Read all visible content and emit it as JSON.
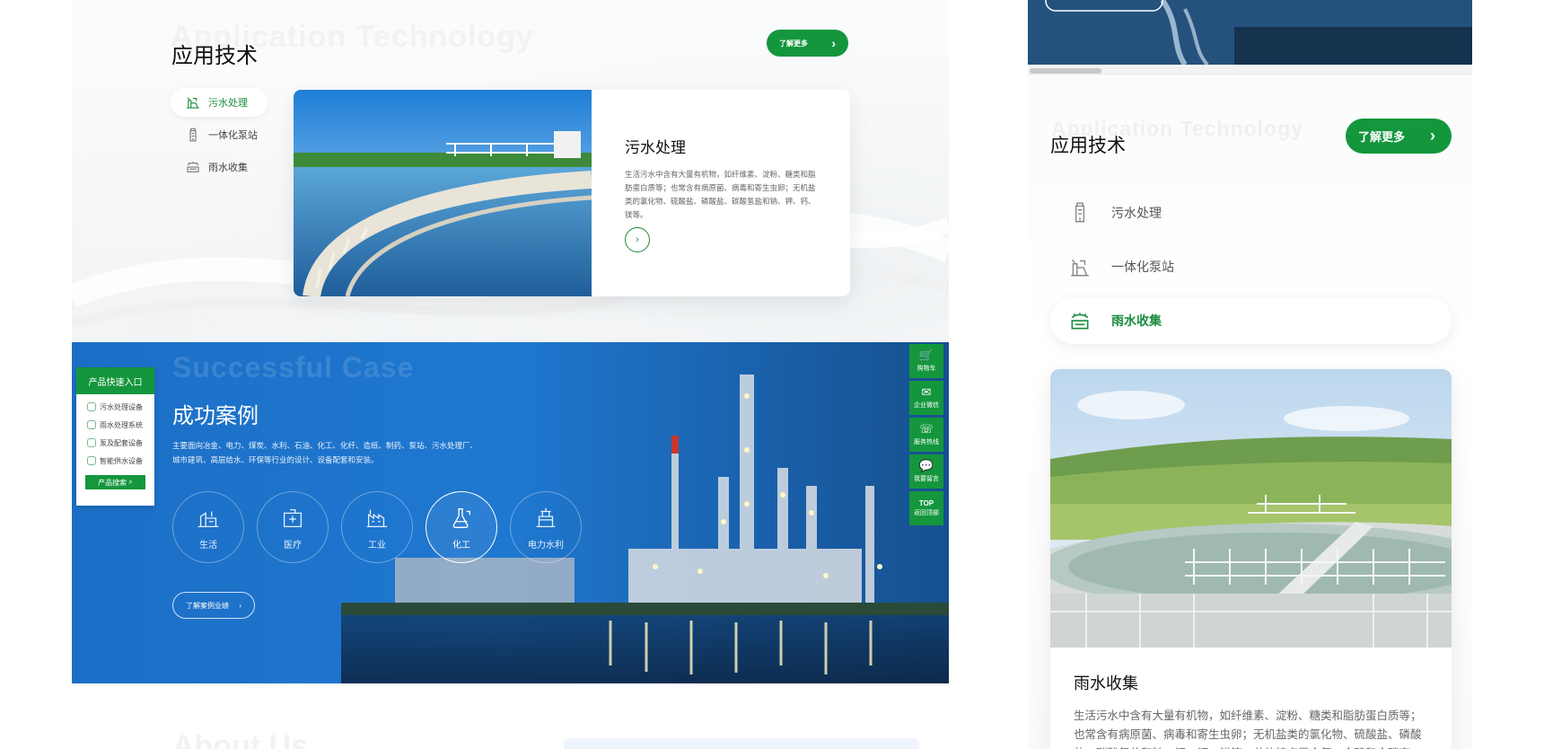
{
  "colors": {
    "brand_green": "#14963d",
    "blue": "#1f6fc7",
    "text_dark": "#111111"
  },
  "desktop": {
    "app_section": {
      "ghost_title": "Application Technology",
      "title": "应用技术",
      "more_label": "了解更多",
      "tabs": [
        {
          "label": "污水处理",
          "icon": "sewage-icon",
          "active": true
        },
        {
          "label": "一体化泵站",
          "icon": "pump-station-icon",
          "active": false
        },
        {
          "label": "雨水收集",
          "icon": "rain-collection-icon",
          "active": false
        }
      ],
      "card": {
        "title": "污水处理",
        "desc": "生活污水中含有大量有机物，如纤维素、淀粉、糖类和脂肪蛋白质等；也常含有病原菌、病毒和寄生虫卵；无机盐类的氯化物、硫酸盐、磷酸盐、碳酸氢盐和钠、钾、钙、镁等。"
      }
    },
    "case_section": {
      "ghost_title": "Successful Case",
      "title": "成功案例",
      "desc": "主要面向冶金、电力、煤炭、水利、石油、化工、化纤、造纸、制药、泵站、污水处理厂、城市建筑、高层给水、环保等行业的设计、设备配套和安装。",
      "categories": [
        {
          "label": "生活",
          "active": false
        },
        {
          "label": "医疗",
          "active": false
        },
        {
          "label": "工业",
          "active": false
        },
        {
          "label": "化工",
          "active": true
        },
        {
          "label": "电力水利",
          "active": false
        }
      ],
      "more_label": "了解案例业绩"
    },
    "quick_entry": {
      "title": "产品快速入口",
      "items": [
        "污水处理设备",
        "雨水处理系统",
        "泵及配套设备",
        "智能供水设备"
      ],
      "search_label": "产品搜索"
    },
    "side_tools": [
      {
        "label": "购物车",
        "icon": "cart-icon",
        "glyph": "🛒"
      },
      {
        "label": "企业微信",
        "icon": "wechat-icon",
        "glyph": "✉"
      },
      {
        "label": "服务热线",
        "icon": "phone-icon",
        "glyph": "☏"
      },
      {
        "label": "我要留言",
        "icon": "message-icon",
        "glyph": "💬"
      },
      {
        "label": "返回顶部",
        "icon": "back-to-top-icon",
        "glyph": "TOP"
      }
    ],
    "about_ghost": "About Us"
  },
  "mobile": {
    "ghost_title": "Application Technology",
    "title": "应用技术",
    "more_label": "了解更多",
    "tabs": [
      {
        "label": "污水处理",
        "icon": "sewage-icon",
        "active": false
      },
      {
        "label": "一体化泵站",
        "icon": "pump-station-icon",
        "active": false
      },
      {
        "label": "雨水收集",
        "icon": "rain-collection-icon",
        "active": true
      }
    ],
    "card": {
      "title": "雨水收集",
      "desc": "生活污水中含有大量有机物，如纤维素、淀粉、糖类和脂肪蛋白质等；也常含有病原菌、病毒和寄生虫卵；无机盐类的氯化物、硫酸盐、磷酸盐、碳酸氢盐和钠、钾、钙、镁等。总的特点是含氮、含硫和含磷高，在厌氧细菌作"
    }
  }
}
